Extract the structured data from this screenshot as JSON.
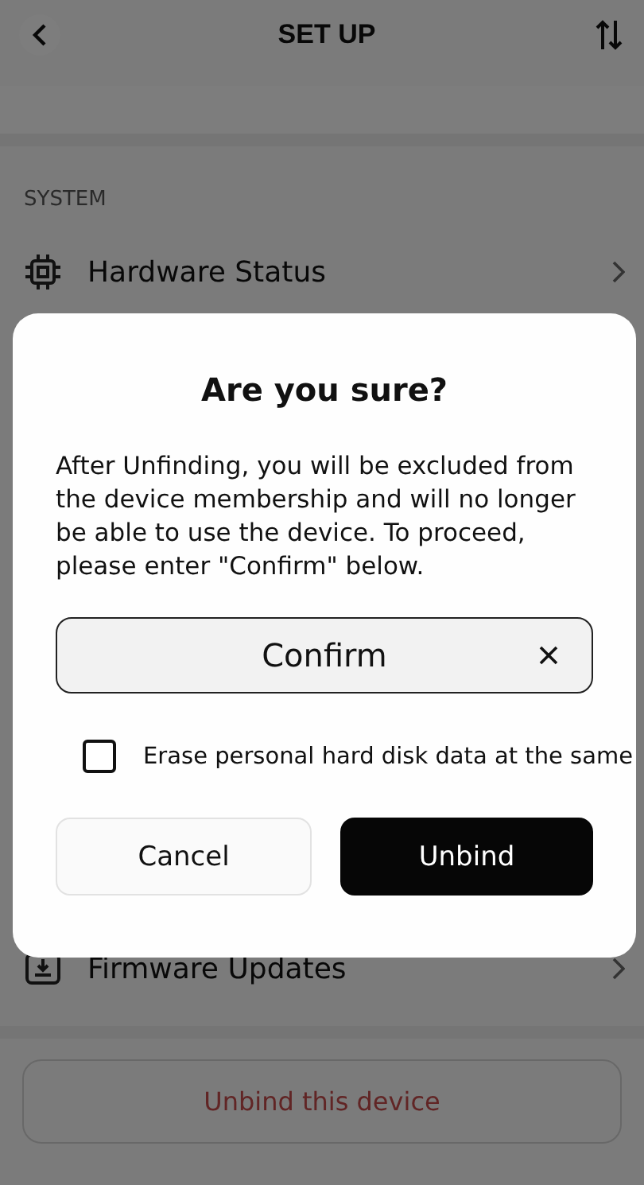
{
  "header": {
    "title": "SET UP"
  },
  "section": {
    "label": "SYSTEM"
  },
  "rows": [
    {
      "label": "Hardware Status",
      "kind": "chip"
    },
    {
      "label": "Firmware Updates",
      "kind": "update"
    }
  ],
  "unbind_button": {
    "label": "Unbind this device"
  },
  "dialog": {
    "title": "Are you sure?",
    "message": "After Unfinding, you will be excluded from the device membership and will no longer be able to use the device. To proceed, please enter \"Confirm\" below.",
    "input": {
      "value": "Confirm"
    },
    "checkbox": {
      "label": "Erase personal hard disk data at the same",
      "checked": false
    },
    "buttons": [
      {
        "label": "Cancel",
        "kind": "secondary"
      },
      {
        "label": "Unbind",
        "kind": "primary"
      }
    ]
  }
}
